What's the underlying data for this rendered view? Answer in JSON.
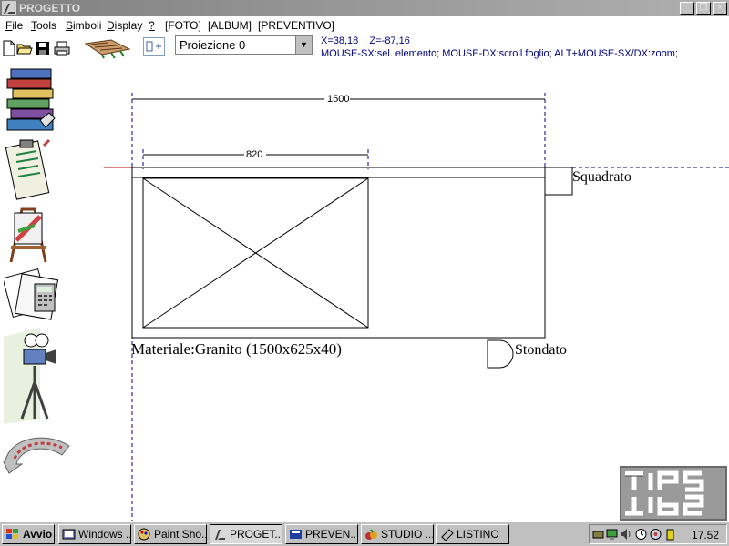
{
  "window": {
    "title": "PROGETTO"
  },
  "menu": [
    {
      "label": "File",
      "accel": "F"
    },
    {
      "label": "Tools",
      "accel": "T"
    },
    {
      "label": "Simboli",
      "accel": "S"
    },
    {
      "label": "Display",
      "accel": "D"
    },
    {
      "label": "?",
      "accel": "?"
    },
    {
      "label": "[FOTO]"
    },
    {
      "label": "[ALBUM]"
    },
    {
      "label": "[PREVENTIVO]"
    }
  ],
  "toolbar": {
    "projection_select": "Proiezione 0",
    "coords": "X=38,18    Z=-87,16",
    "hint": "MOUSE-SX:sel. elemento; MOUSE-DX:scroll foglio; ALT+MOUSE-SX/DX:zoom;"
  },
  "drawing": {
    "dim_total": "1500",
    "dim_inner": "820",
    "label_squared": "Squadrato",
    "label_rounded": "Stondato",
    "material": "Materiale:Granito (1500x625x40)"
  },
  "taskbar": {
    "start": "Avvio",
    "tasks": [
      "Windows ...",
      "Paint Sho...",
      "PROGET...",
      "PREVEN...",
      "STUDIO ...",
      "LISTINO"
    ],
    "clock": "17.52"
  },
  "logo": {
    "text_top": "TIPS",
    "text_bottom": "TIPS"
  }
}
